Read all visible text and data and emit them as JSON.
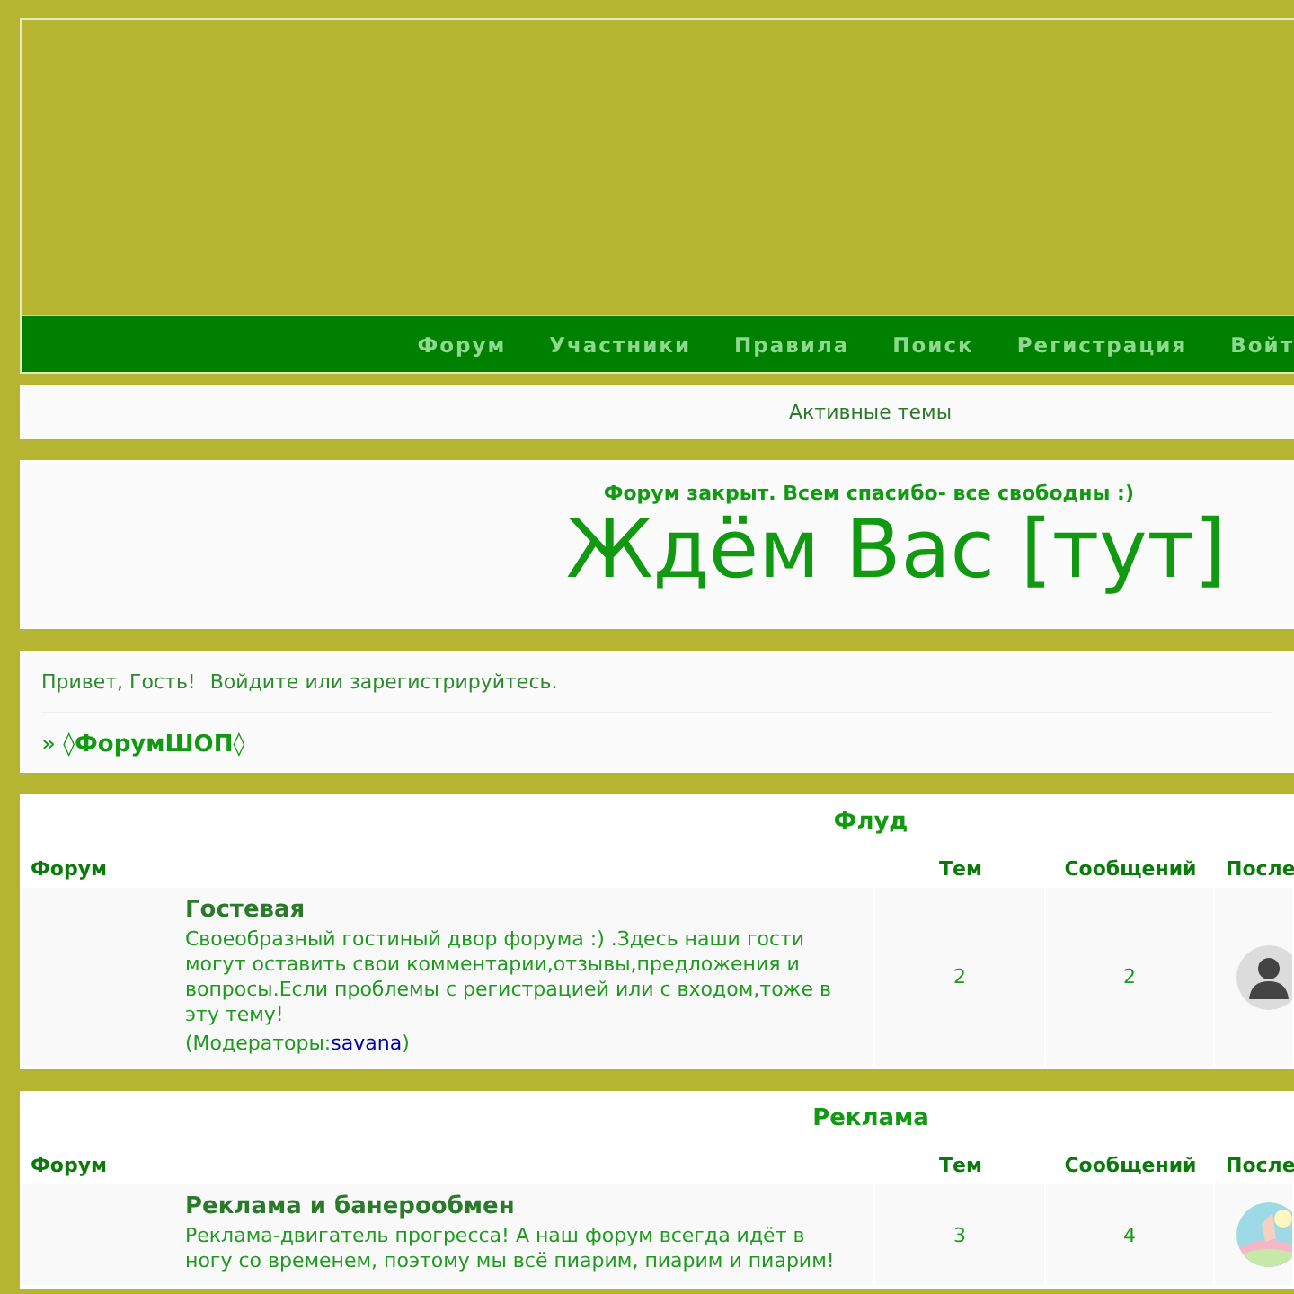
{
  "nav": [
    "Форум",
    "Участники",
    "Правила",
    "Поиск",
    "Регистрация",
    "Войт"
  ],
  "active_topics": "Активные темы",
  "announcement": {
    "notice": "Форум закрыт. Всем спасибо- все свободны :)",
    "headline": "Ждём Вас [тут]"
  },
  "welcome": {
    "greeting": "Привет, Гость!",
    "login": "Войдите или зарегистрируйтесь."
  },
  "breadcrumb": "» ◊**ФорумШОП**◊",
  "categories": [
    {
      "title": "Флуд",
      "columns": [
        "Форум",
        "Тем",
        "Сообщений",
        "После"
      ],
      "forums": [
        {
          "name": "Гостевая",
          "description": "Своеобразный гостиный двор форума :) .Здесь наши гости могут оставить свои комментарии,отзывы,предложения и вопросы.Если проблемы с регистрацией или с входом,тоже в эту тему!",
          "moderators_prefix": "(Модераторы:",
          "moderator": "savana",
          "moderators_suffix": ")",
          "topics": "2",
          "posts": "2",
          "avatar": {
            "kind": "silhouette"
          }
        }
      ]
    },
    {
      "title": "Реклама",
      "columns": [
        "Форум",
        "Тем",
        "Сообщений",
        "После"
      ],
      "forums": [
        {
          "name": "Реклама и банерообмен",
          "description": "Реклама-двигатель прогресса! А наш форум всегда идёт в ногу со временем, поэтому мы всё пиарим, пиарим и пиарим!",
          "topics": "3",
          "posts": "4"
        }
      ]
    }
  ]
}
